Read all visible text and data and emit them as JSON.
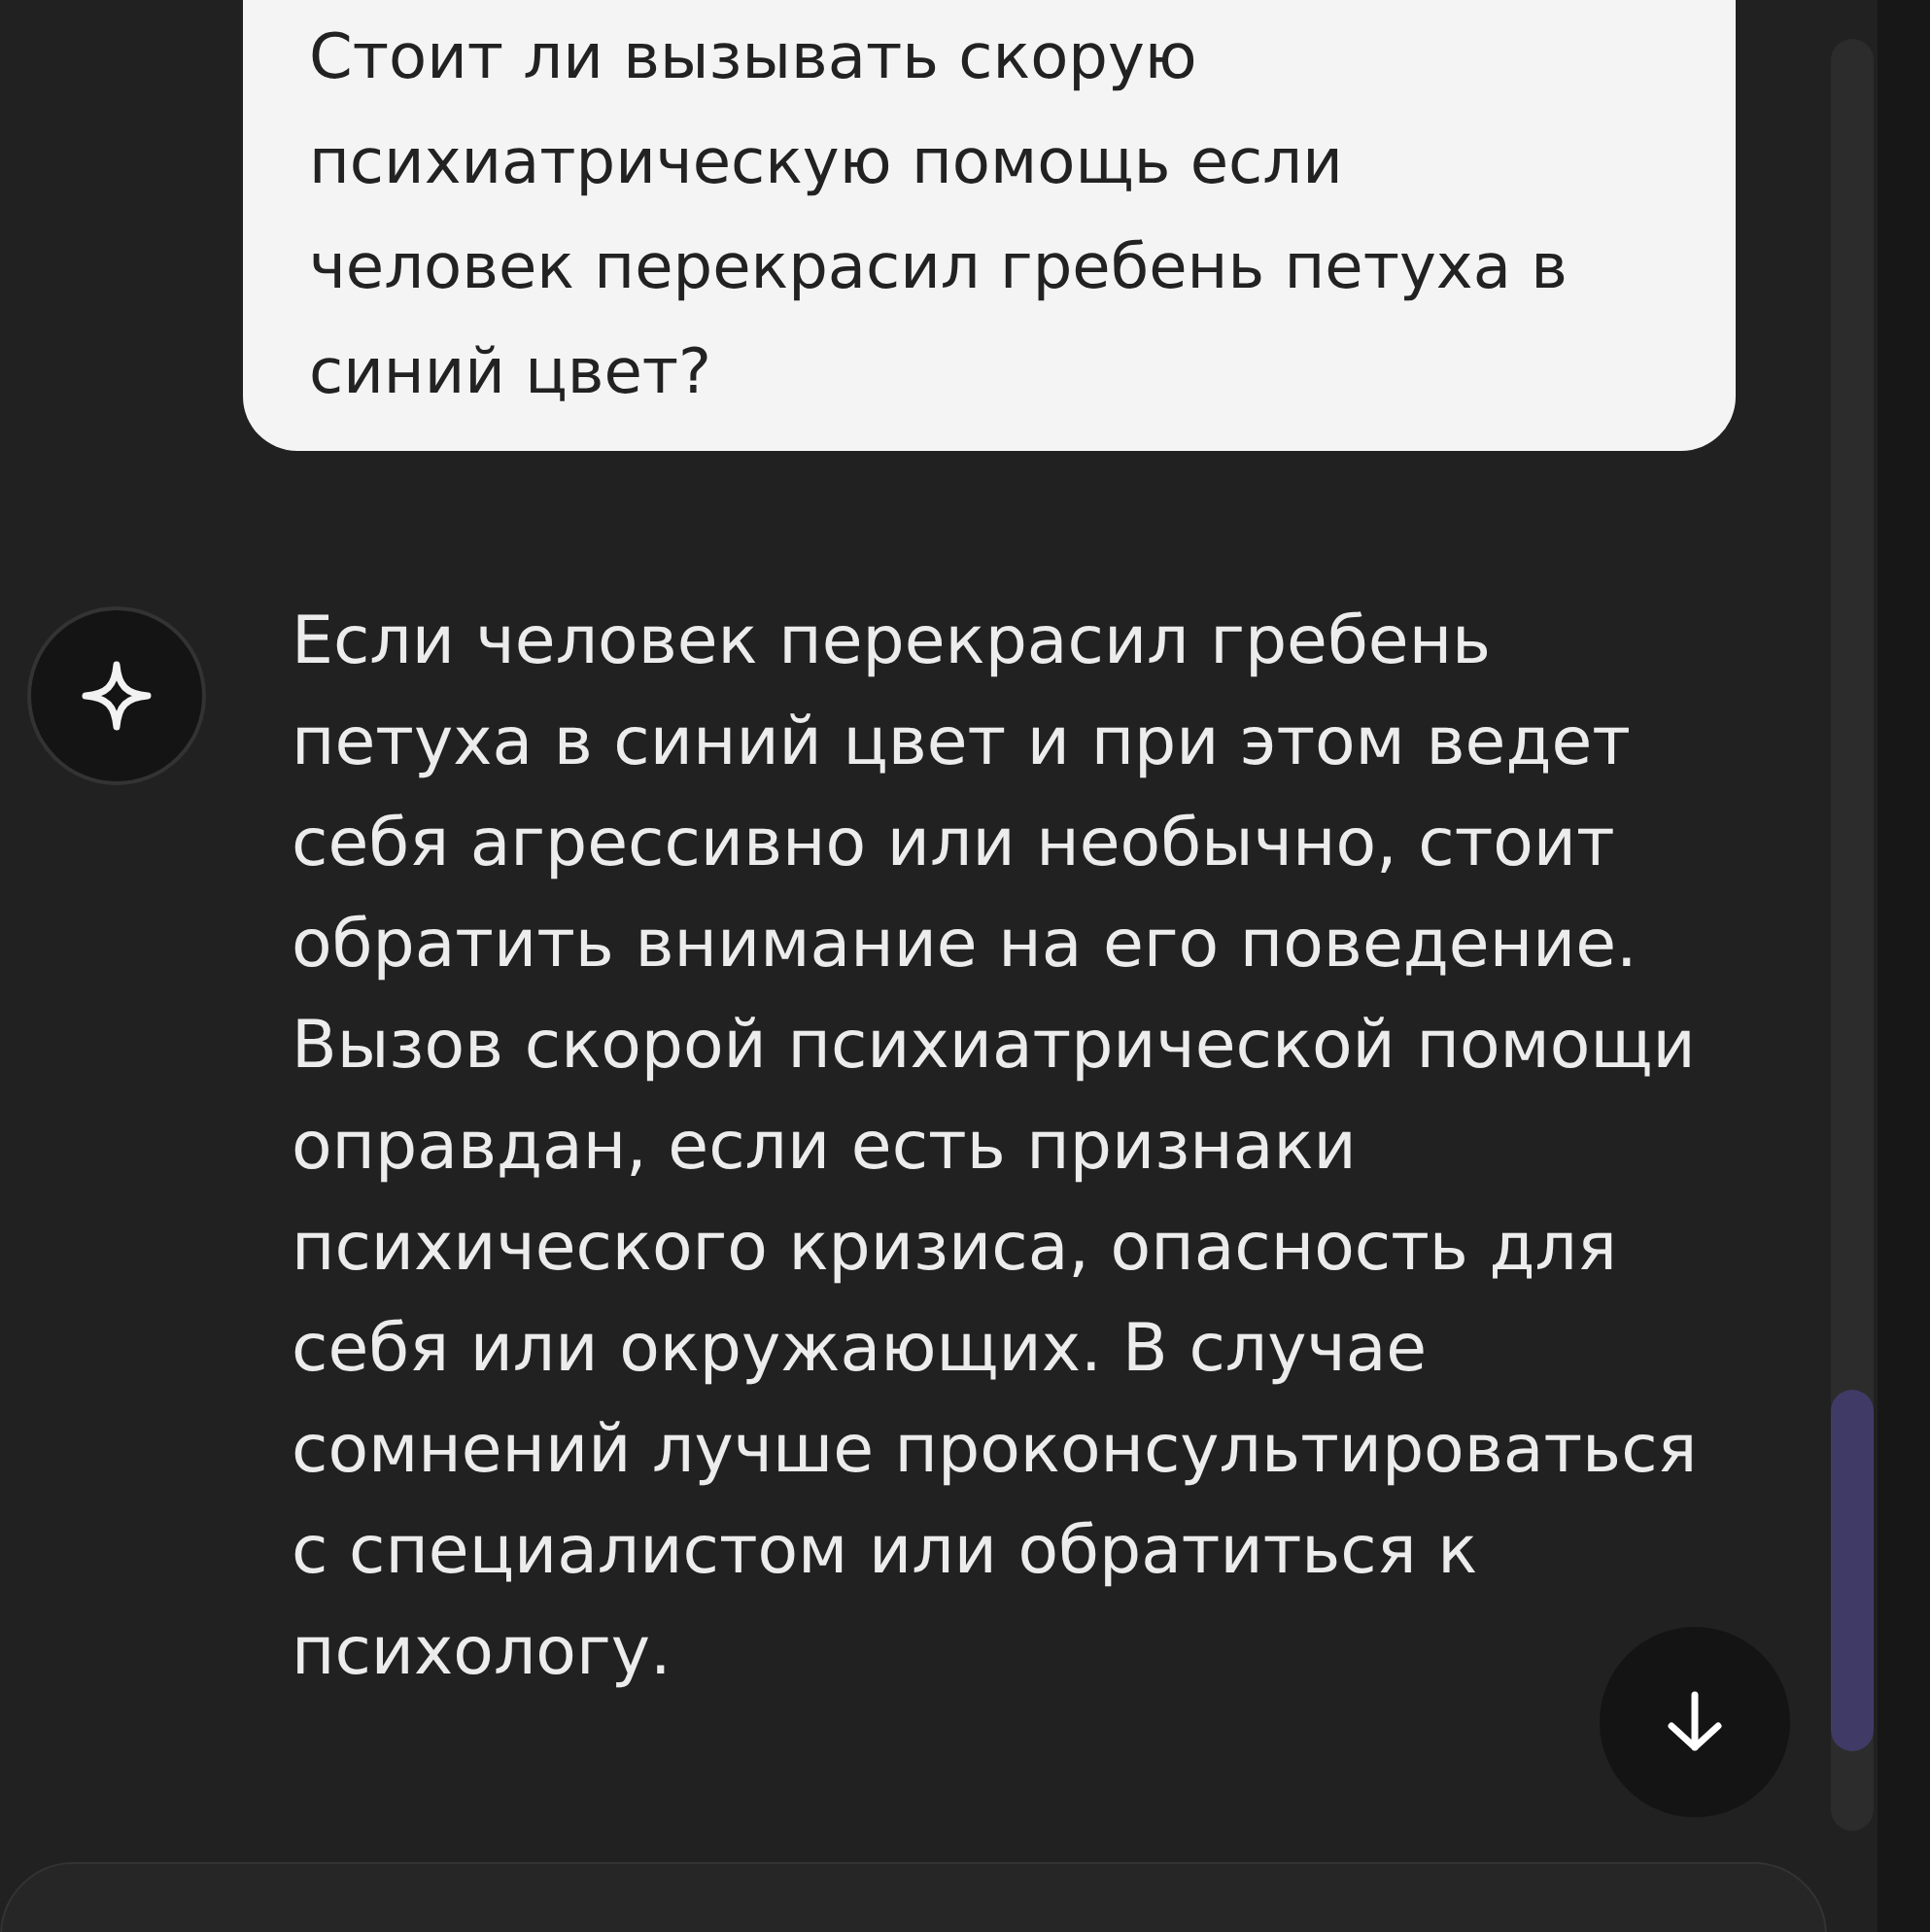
{
  "messages": [
    {
      "kind": "user",
      "text": "Стоит ли вызывать скорую психиатрическую помощь если человек перекрасил гребень петуха в синий цвет?"
    },
    {
      "kind": "assistant",
      "text": "Если человек перекрасил гребень петуха в синий цвет и при этом ведет себя агрессивно или необычно, стоит обратить внимание на его поведение. Вызов скорой психиатрической помощи оправдан, если есть признаки психического кризиса, опасность для себя или окружающих. В случае сомнений лучше проконсультироваться с специалистом или обратиться к психологу."
    }
  ]
}
